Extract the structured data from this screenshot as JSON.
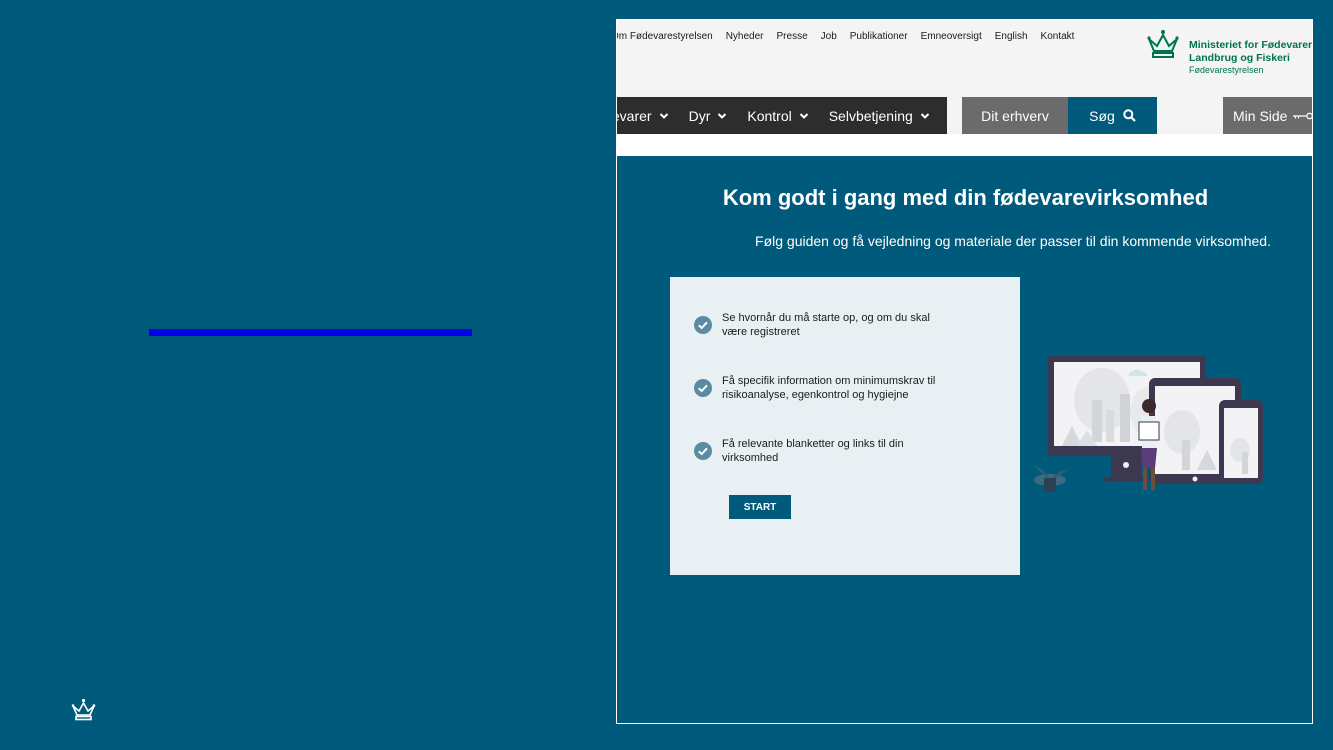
{
  "site": {
    "toplinks": [
      "Om Fødevarestyrelsen",
      "Nyheder",
      "Presse",
      "Job",
      "Publikationer",
      "Emneoversigt",
      "English",
      "Kontakt"
    ],
    "logo": {
      "line1": "Ministeriet for Fødevarer,",
      "line2": "Landbrug og Fiskeri",
      "line3": "Fødevarestyrelsen"
    },
    "nav": {
      "items": [
        "Fødevarer",
        "Dyr",
        "Kontrol",
        "Selvbetjening"
      ],
      "erhverv": "Dit erhverv",
      "search": "Søg",
      "minside": "Min Side"
    },
    "hero": {
      "title": "Kom godt i gang med din fødevarevirksomhed",
      "subtitle": "Følg guiden og få vejledning og materiale der passer til din kommende virksomhed."
    },
    "card": {
      "items": [
        "Se hvornår du må starte op, og om du skal være registreret",
        "Få specifik information om minimumskrav til risikoanalyse, egenkontrol og hygiejne",
        "Få relevante blanketter og links til din virksomhed"
      ],
      "button": "START"
    }
  },
  "colors": {
    "background": "#005a7b",
    "accent_bar": "#0000ee",
    "nav_dark": "#2d2d2d",
    "nav_grey": "#6b6b6b",
    "card_bg": "#e9f0f3",
    "logo_green": "#00744c"
  },
  "icons": [
    "crown-icon",
    "chevron-down-icon",
    "search-icon",
    "key-icon",
    "check-circle-icon"
  ]
}
